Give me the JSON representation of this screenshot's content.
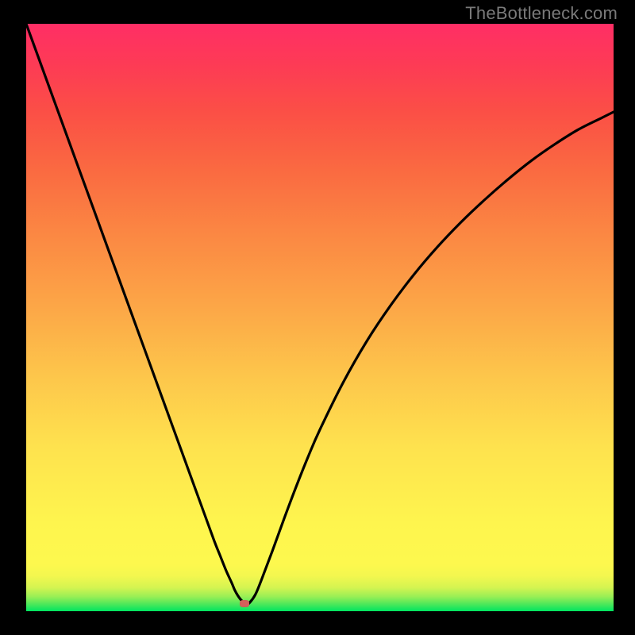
{
  "watermark": "TheBottleneck.com",
  "marker": {
    "x_norm": 0.372,
    "y_norm": 0.987
  },
  "chart_data": {
    "type": "line",
    "title": "",
    "xlabel": "",
    "ylabel": "",
    "xlim": [
      0,
      1
    ],
    "ylim": [
      0,
      1
    ],
    "x": [
      0.0,
      0.02,
      0.04,
      0.06,
      0.08,
      0.1,
      0.12,
      0.14,
      0.16,
      0.18,
      0.2,
      0.22,
      0.24,
      0.26,
      0.28,
      0.3,
      0.32,
      0.33,
      0.34,
      0.35,
      0.355,
      0.36,
      0.365,
      0.37,
      0.375,
      0.38,
      0.39,
      0.4,
      0.42,
      0.44,
      0.46,
      0.48,
      0.5,
      0.54,
      0.58,
      0.62,
      0.66,
      0.7,
      0.74,
      0.78,
      0.82,
      0.86,
      0.9,
      0.94,
      0.98,
      1.0
    ],
    "values": [
      1.0,
      0.945,
      0.89,
      0.835,
      0.78,
      0.725,
      0.67,
      0.615,
      0.56,
      0.505,
      0.45,
      0.395,
      0.34,
      0.285,
      0.23,
      0.175,
      0.12,
      0.095,
      0.07,
      0.048,
      0.036,
      0.027,
      0.02,
      0.015,
      0.012,
      0.014,
      0.028,
      0.052,
      0.105,
      0.16,
      0.213,
      0.263,
      0.309,
      0.39,
      0.46,
      0.52,
      0.573,
      0.62,
      0.662,
      0.7,
      0.735,
      0.767,
      0.795,
      0.82,
      0.84,
      0.85
    ],
    "grid": false,
    "legend": false,
    "background": "rainbow-vertical"
  }
}
